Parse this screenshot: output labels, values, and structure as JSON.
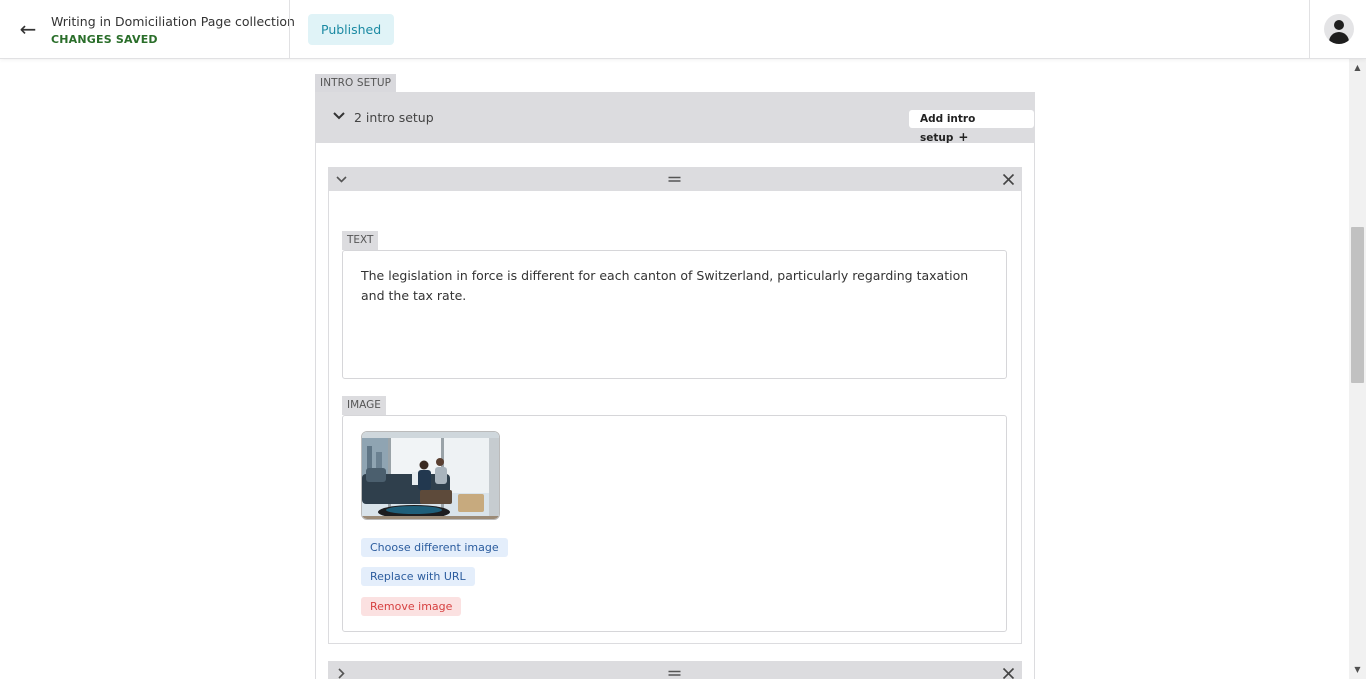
{
  "header": {
    "back_icon": "arrow-left-icon",
    "title": "Writing in Domiciliation Page collection",
    "save_status": "CHANGES SAVED",
    "status_badge": "Published",
    "avatar_icon": "user-avatar-icon"
  },
  "colors": {
    "saved_green": "#2a6e2a",
    "badge_bg": "#e0f3f7",
    "badge_text": "#1b8aa3",
    "panel_gray": "#dcdcdf",
    "link_blue": "#2b5c9e",
    "danger_red": "#d64040"
  },
  "intro_setup": {
    "section_label": "INTRO SETUP",
    "count_label": "2 intro setup",
    "add_button": "Add intro setup",
    "items": [
      {
        "expanded": true,
        "text_label": "TEXT",
        "text_value": "The legislation in force is different for each canton of Switzerland, particularly regarding taxation and the tax rate.",
        "image_label": "IMAGE",
        "image_alt": "Two businessmen on a sofa in an office",
        "choose_image": "Choose different image",
        "replace_url": "Replace with URL",
        "remove_image": "Remove image"
      },
      {
        "expanded": false
      }
    ]
  }
}
